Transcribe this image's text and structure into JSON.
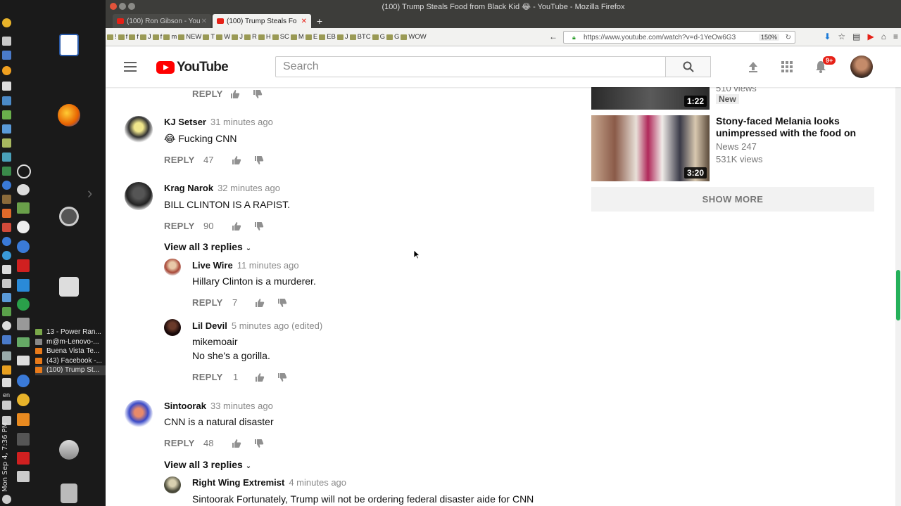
{
  "window": {
    "title": "(100) Trump Steals Food from Black Kid 😂 - YouTube - Mozilla Firefox"
  },
  "tabs": [
    {
      "label": "(100) Ron Gibson - You",
      "selected": false
    },
    {
      "label": "(100) Trump Steals Fo",
      "selected": true
    }
  ],
  "bookmarks": [
    "!",
    "f",
    "f",
    "J",
    "f",
    "m",
    "NEW",
    "T",
    "W",
    "J",
    "R",
    "H",
    "SC",
    "M",
    "E",
    "EB",
    "J",
    "BTC",
    "G",
    "G",
    "WOW"
  ],
  "url": {
    "value": "https://www.youtube.com/watch?v=d-1YeOw6G3",
    "zoom": "150%"
  },
  "taskbar": {
    "clock": "Mon Sep 4, 7:36 PM",
    "lang": "en",
    "tasks": [
      {
        "label": "13 - Power Ran...",
        "color": "#7aa84a"
      },
      {
        "label": "m@m-Lenovo-...",
        "color": "#444"
      },
      {
        "label": "Buena Vista Te...",
        "color": "#e87a1a"
      },
      {
        "label": "(43) Facebook -...",
        "color": "#e87a1a"
      },
      {
        "label": "(100) Trump St...",
        "color": "#e87a1a"
      }
    ]
  },
  "youtube": {
    "logo_text": "YouTube",
    "search_placeholder": "Search",
    "notification_count": "9+"
  },
  "comments": {
    "top_reply": "REPLY",
    "items": [
      {
        "author": "KJ Setser",
        "time": "31 minutes ago",
        "text": "😂 Fucking CNN",
        "reply": "REPLY",
        "likes": "47"
      },
      {
        "author": "Krag Narok",
        "time": "32 minutes ago",
        "text": "BILL CLINTON IS A RAPIST.",
        "reply": "REPLY",
        "likes": "90",
        "view_all": "View all 3 replies"
      },
      {
        "author": "Live Wire",
        "time": "11 minutes ago",
        "text": "Hillary Clinton is a murderer.",
        "reply": "REPLY",
        "likes": "7"
      },
      {
        "author": "Lil Devil",
        "time": "5 minutes ago (edited)",
        "text": "mikemoair",
        "text2": "No she's a gorilla.",
        "reply": "REPLY",
        "likes": "1"
      },
      {
        "author": "Sintoorak",
        "time": "33 minutes ago",
        "text": "CNN is a natural disaster",
        "reply": "REPLY",
        "likes": "48",
        "view_all": "View all 3 replies"
      },
      {
        "author": "Right Wing Extremist",
        "time": "4 minutes ago",
        "text": "Sintoorak Fortunately, Trump will not be ordering federal disaster aide for CNN"
      }
    ]
  },
  "sidebar": {
    "videos": [
      {
        "title": "",
        "meta1": "510 views",
        "badge": "New",
        "duration": "1:22"
      },
      {
        "title": "Stony-faced Melania looks unimpressed with the food on",
        "meta1": "News 247",
        "meta2": "531K views",
        "duration": "3:20"
      }
    ],
    "show_more": "SHOW MORE"
  }
}
